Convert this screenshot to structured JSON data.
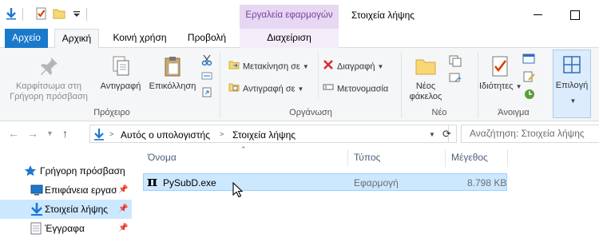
{
  "window": {
    "title": "Στοιχεία λήψης",
    "context_tab_header": "Εργαλεία εφαρμογών"
  },
  "tabs": {
    "file": "Αρχείο",
    "home": "Αρχική",
    "share": "Κοινή χρήση",
    "view": "Προβολή",
    "manage": "Διαχείριση"
  },
  "ribbon": {
    "clipboard": {
      "label": "Πρόχειρο",
      "pin": "Καρφίτσωμα στη Γρήγορη πρόσβαση",
      "copy": "Αντιγραφή",
      "paste": "Επικόλληση"
    },
    "organize": {
      "label": "Οργάνωση",
      "move_to": "Μετακίνηση σε",
      "copy_to": "Αντιγραφή σε",
      "delete": "Διαγραφή",
      "rename": "Μετονομασία"
    },
    "new": {
      "label": "Νέο",
      "new_folder": "Νέος φάκελος"
    },
    "open": {
      "label": "Άνοιγμα",
      "properties": "Ιδιότητες"
    },
    "select": {
      "label": "Επιλογή"
    }
  },
  "address": {
    "crumbs": [
      "Αυτός ο υπολογιστής",
      "Στοιχεία λήψης"
    ],
    "search_placeholder": "Αναζήτηση: Στοιχεία λήψης"
  },
  "nav_pane": {
    "items": [
      {
        "label": "Γρήγορη πρόσβαση"
      },
      {
        "label": "Επιφάνεια εργασ"
      },
      {
        "label": "Στοιχεία λήψης"
      },
      {
        "label": "Έγγραφα"
      }
    ]
  },
  "file_list": {
    "columns": {
      "name": "Όνομα",
      "type": "Τύπος",
      "size": "Μέγεθος"
    },
    "rows": [
      {
        "name": "PySubD.exe",
        "type": "Εφαρμογή",
        "size": "8.798 KB"
      }
    ]
  },
  "colors": {
    "accent": "#1979ca",
    "context": "#e6d7f2",
    "selection": "#cce8ff"
  }
}
